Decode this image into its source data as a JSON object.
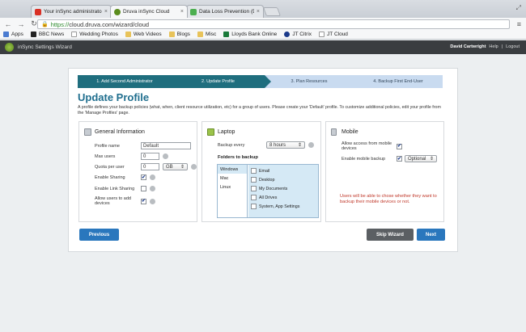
{
  "browser": {
    "tabs": [
      {
        "title": "Your inSync administrator",
        "favicon_color": "#d93025"
      },
      {
        "title": "Druva inSync Cloud",
        "favicon_color": "#5b8c1e"
      },
      {
        "title": "Data Loss Prevention (DLP",
        "favicon_color": "#4caf50"
      }
    ],
    "url_scheme": "https://",
    "url_rest": "cloud.druva.com/wizard/cloud",
    "bookmarks": [
      "Apps",
      "BBC News",
      "Wedding Photos",
      "Web Videos",
      "Blogs",
      "Misc",
      "Lloyds Bank Online",
      "JT Citrix",
      "JT Cloud"
    ]
  },
  "app": {
    "title": "inSync Settings Wizard",
    "user": "David Cartwright",
    "help": "Help",
    "sep": "|",
    "logout": "Logout"
  },
  "steps": [
    "1. Add Second Administrator",
    "2. Update Profile",
    "3. Plan Resources",
    "4. Backup First End-User"
  ],
  "page": {
    "title": "Update Profile",
    "description": "A profile defines your backup policies (what, when, client resource utilization, etc) for a group of users. Please create your 'Default' profile. To customize additional policies, edit your profile from the 'Manage Profiles' page."
  },
  "general": {
    "title": "General Information",
    "profile_name_label": "Profile name",
    "profile_name_value": "Default",
    "max_users_label": "Max users",
    "max_users_value": "0",
    "quota_label": "Quota per user",
    "quota_value": "0",
    "quota_unit": "GB",
    "sharing_label": "Enable Sharing",
    "sharing_checked": true,
    "link_sharing_label": "Enable Link Sharing",
    "link_sharing_checked": false,
    "add_devices_label": "Allow users to add devices",
    "add_devices_checked": true
  },
  "laptop": {
    "title": "Laptop",
    "backup_every_label": "Backup every",
    "backup_every_value": "8 hours",
    "folders_title": "Folders to backup",
    "os": [
      "Windows",
      "Mac",
      "Linux"
    ],
    "folders": [
      "Email",
      "Desktop",
      "My Documents",
      "All Drives",
      "System, App Settings"
    ]
  },
  "mobile": {
    "title": "Mobile",
    "allow_label": "Allow access from mobile devices",
    "allow_checked": true,
    "enable_backup_label": "Enable mobile backup",
    "enable_backup_checked": true,
    "backup_mode": "Optional",
    "note": "Users will be able to chose whether they want to backup their mobile devices or not."
  },
  "buttons": {
    "previous": "Previous",
    "skip": "Skip Wizard",
    "next": "Next"
  },
  "colors": {
    "accent": "#1f6e7e",
    "button_primary": "#2a77bd",
    "button_secondary": "#5b5f63",
    "title_color": "#1f6e8e",
    "note_color": "#c0392b"
  }
}
